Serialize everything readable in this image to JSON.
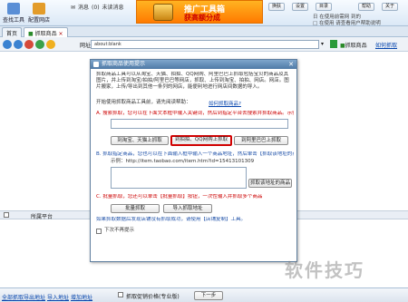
{
  "toolbar": {
    "tools": [
      {
        "name": "find-tools",
        "label": "查找工具"
      },
      {
        "name": "config-site",
        "label": "配置网店"
      }
    ],
    "message_label": "消息",
    "message_count": "(0)",
    "unread_label": "未读消息",
    "banner": {
      "line1": "推广工具箱",
      "line2": "获高额分成"
    },
    "menu": [
      "换肤",
      "设置",
      "目录",
      "帮助",
      "关于"
    ],
    "small_toggle": "",
    "right_text1": "日 在使用前需网  到的",
    "right_text2": "□ 在使用 请查看用户帮助说明"
  },
  "tabs": [
    {
      "label": "首页"
    },
    {
      "label": "抓取商品"
    }
  ],
  "address": {
    "label": "网址",
    "value": "about:blank",
    "grab_button": "抓取商品",
    "help_link": "如何抓取"
  },
  "dialog": {
    "title": "抓取商品使用提示",
    "intro": "抓取商品工具可以从淘宝、天猫、拍拍、QQ网购、阿里巴巴上抓取包括宝贝的商品及其图片，并上传到淘宝/拍拍/阿里巴巴等网店，抓取、上传到淘宝、拍拍、网店。网店。图片搬家，上传/导出到其他一条列的网店，能便利地进行网店间数据的导入。",
    "prompt": "开始使用抓取商品工具前，请先阅读帮助：",
    "prompt_link": "如何抓取商品?",
    "section_a": {
      "title": "A. 搜索抓取，您可以在下面文本框中输入关键词，然后到指定平台去搜索并抓取商品。示例：连衣裙",
      "buttons": [
        "到淘宝、天猫上抓取",
        "到拍拍、QQ网购上抓取",
        "到阿里巴巴上抓取"
      ]
    },
    "section_b": {
      "title": "B. 抓取指定商品，您也可以在下面输入框中输入一个商品地址，然后单击【抓取该地址的商品】",
      "example": "示例：http://item.taobao.com/item.htm?id=15413101309",
      "button": "抓取该地址的商品"
    },
    "section_c": {
      "title": "C. 批量抓取，您还可以单击【批量抓取】按钮，一次性输入并抓取多个商品",
      "buttons": [
        "批量抓取",
        "导入抓取地址"
      ]
    },
    "footer_text": "如果抓取数据后发现店铺没有抓取成功，请使用【店铺复制】工具。",
    "no_more_label": "下次不再提示"
  },
  "grid": {
    "header": [
      "所属平台"
    ]
  },
  "bottom": {
    "links": [
      "全部抓取",
      "导出地址",
      "导入地址",
      "增加地址"
    ],
    "checkbox_label": "抓取促销价格(专业版)",
    "next_button": "下一步"
  },
  "watermark": "软件技巧",
  "colors": {
    "accent": "#4f7aa6",
    "highlight": "#d10000",
    "banner": "#ff8c00"
  }
}
